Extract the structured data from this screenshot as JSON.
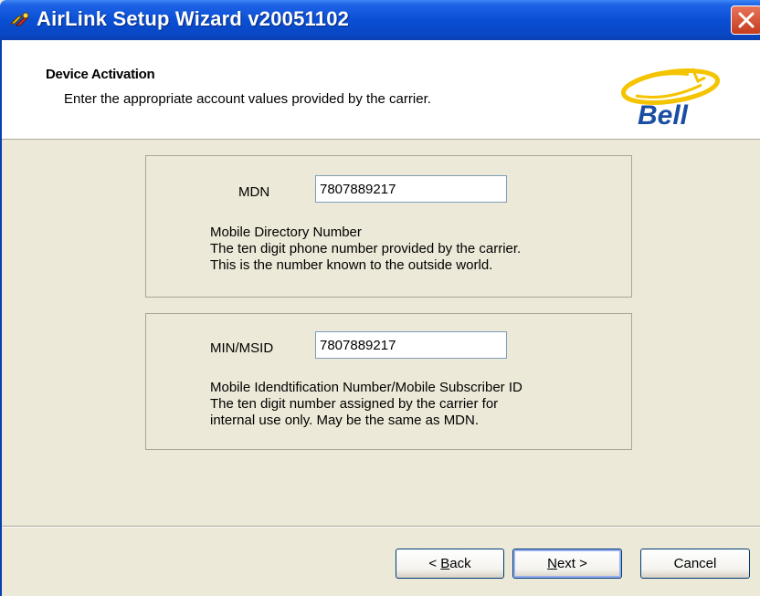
{
  "window": {
    "title": "AirLink Setup Wizard v20051102"
  },
  "header": {
    "title": "Device Activation",
    "subtitle": "Enter the appropriate account values provided by the carrier.",
    "logo_text": "Bell"
  },
  "mdn": {
    "label": "MDN",
    "value": "7807889217",
    "desc_line1": "Mobile Directory Number",
    "desc_line2": "The ten digit phone number provided by the carrier.",
    "desc_line3": "This is the number known to the outside world."
  },
  "min": {
    "label": "MIN/MSID",
    "value": "7807889217",
    "desc_line1": "Mobile Idendtification Number/Mobile Subscriber ID",
    "desc_line2": "The ten digit number assigned by the carrier for",
    "desc_line3": "internal use only. May be the same as MDN."
  },
  "buttons": {
    "back_prefix": "< ",
    "back_mnemonic": "B",
    "back_rest": "ack",
    "next_mnemonic": "N",
    "next_rest": "ext >",
    "cancel": "Cancel"
  },
  "colors": {
    "titlebar": "#0a4fd4",
    "dialog": "#ece9d8",
    "logo_yellow": "#f5c400",
    "logo_blue": "#1a4ea3"
  }
}
